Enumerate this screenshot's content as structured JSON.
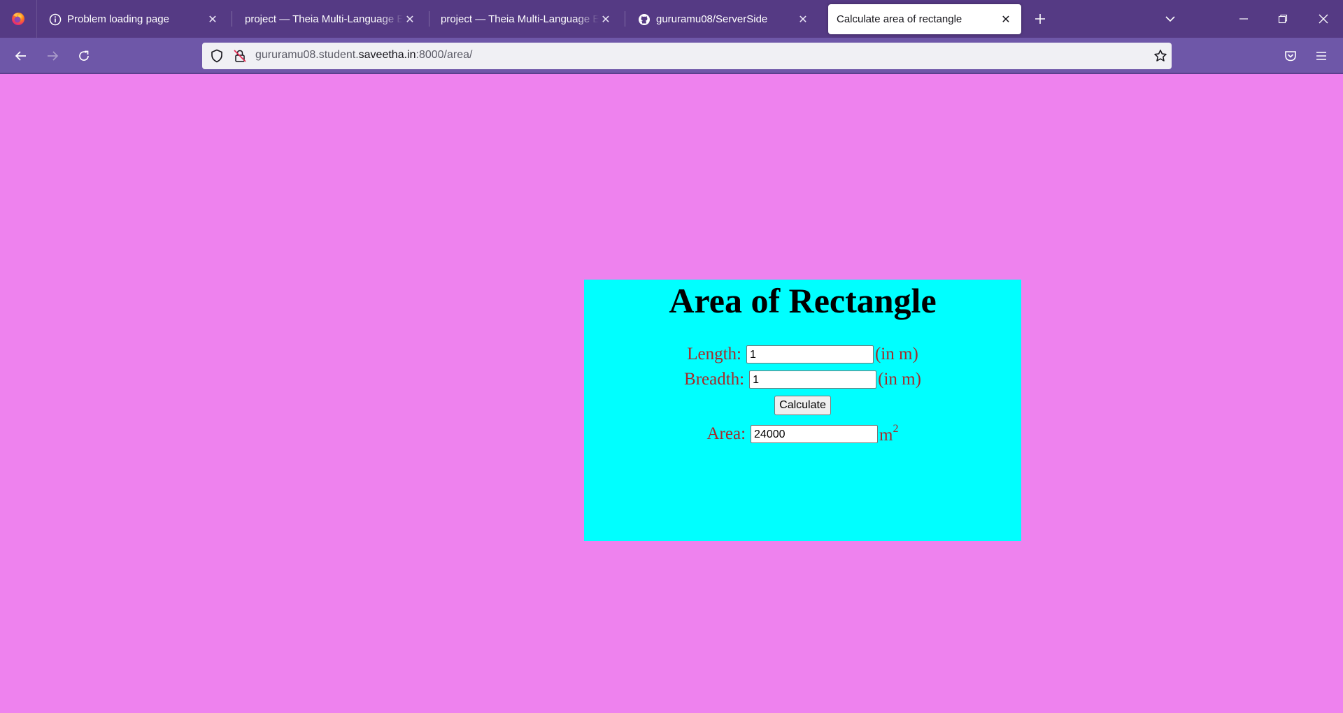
{
  "browser": {
    "tabs": [
      {
        "title": "Problem loading page",
        "favicon": "info-icon",
        "active": false
      },
      {
        "title": "project — Theia Multi-Language Ex",
        "favicon": "none",
        "active": false
      },
      {
        "title": "project — Theia Multi-Language Ex",
        "favicon": "none",
        "active": false
      },
      {
        "title": "gururamu08/ServerSide",
        "favicon": "github-icon",
        "active": false
      },
      {
        "title": "Calculate area of rectangle",
        "favicon": "none",
        "active": true
      }
    ],
    "url": {
      "prefix": "gururamu08.student.",
      "domain": "saveetha.in",
      "suffix": ":8000/area/"
    },
    "colors": {
      "tabbar": "#553a84",
      "navbar": "#6e57a8"
    }
  },
  "page": {
    "background": "#ee82ee",
    "card_background": "#00ffff",
    "title": "Area of Rectangle",
    "length": {
      "label": "Length:",
      "value": "1",
      "unit": "(in m)"
    },
    "breadth": {
      "label": "Breadth:",
      "value": "1",
      "unit": "(in m)"
    },
    "calculate_label": "Calculate",
    "area": {
      "label": "Area:",
      "value": "24000",
      "unit_base": "m",
      "unit_exp": "2"
    }
  }
}
